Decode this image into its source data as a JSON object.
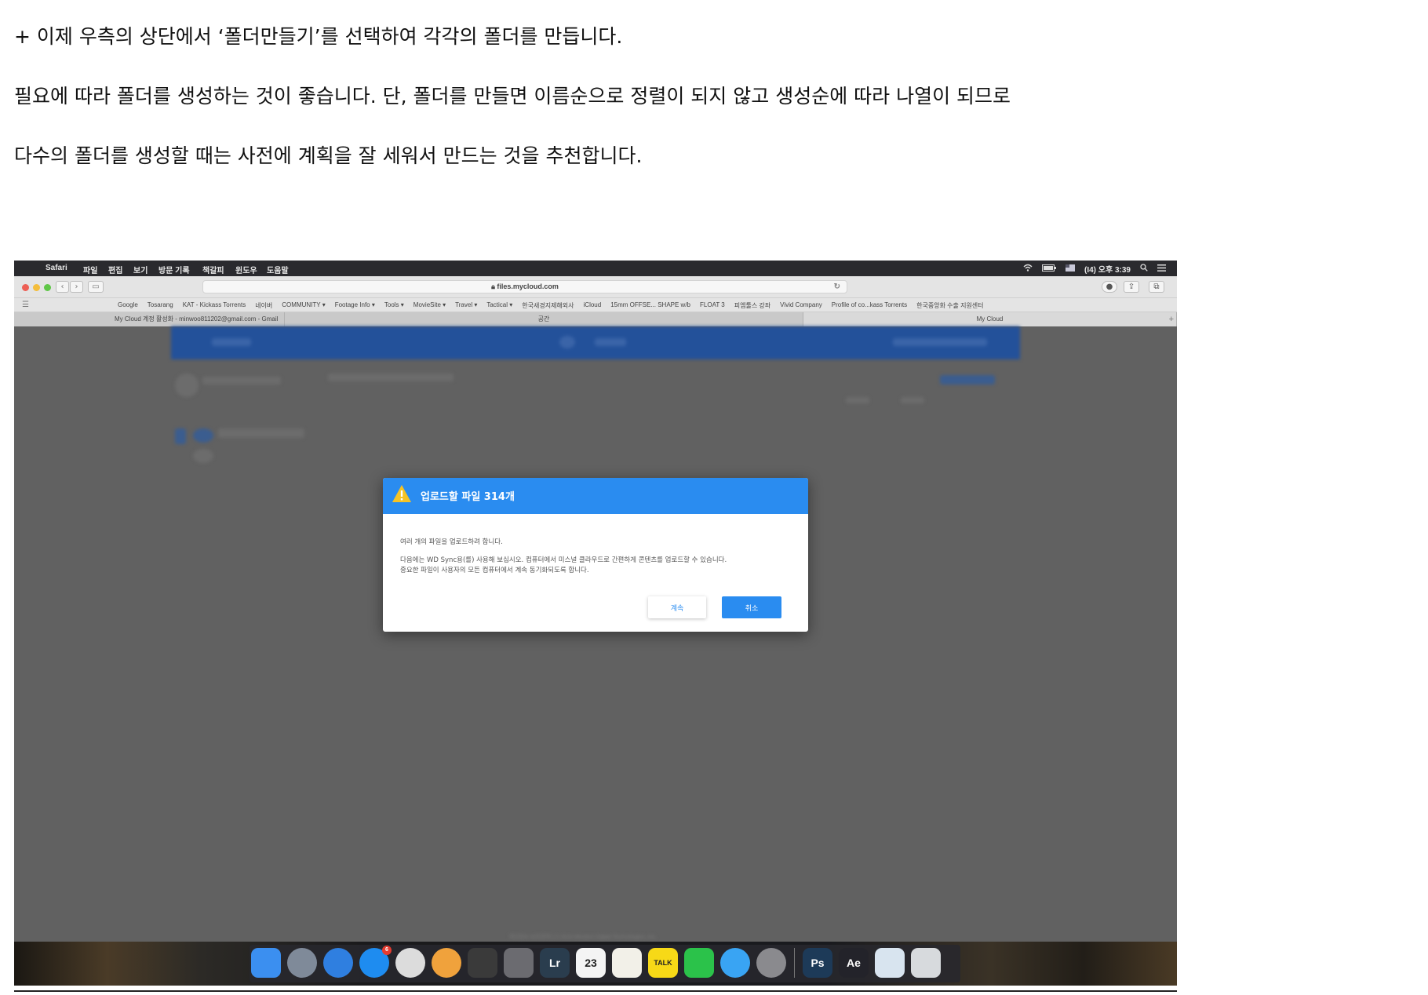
{
  "article": {
    "line1": "+ 이제 우측의 상단에서 ‘폴더만들기’를 선택하여 각각의 폴더를 만듭니다.",
    "line2": "필요에 따라 폴더를 생성하는 것이 좋습니다. 단, 폴더를 만들면 이름순으로 정렬이 되지 않고 생성순에 따라 나열이 되므로",
    "line3": "다수의 폴더를 생성할 때는 사전에 계획을 잘 세워서 만드는 것을 추천합니다."
  },
  "menubar": {
    "app": "Safari",
    "items": [
      "파일",
      "편집",
      "보기",
      "방문 기록",
      "책갈피",
      "윈도우",
      "도움말"
    ],
    "clock": "(I4) 오후 3:39"
  },
  "toolbar": {
    "url": "files.mycloud.com"
  },
  "bookmarks": [
    "Google",
    "Tosarang",
    "KAT - Kickass Torrents",
    "네이버",
    "COMMUNITY ▾",
    "Footage Info ▾",
    "Tools ▾",
    "MovieSite ▾",
    "Travel ▾",
    "Tactical ▾",
    "한국새경지제해외사",
    "iCloud",
    "15mm OFFSE... SHAPE w/b",
    "FLOAT 3",
    "피엠툴스 강좌",
    "Vivid Company",
    "Profile of co...kass Torrents",
    "한국중앙화 수출 지원센터"
  ],
  "tabs": [
    {
      "label": "My Cloud 계정 활성화 - minwoo811202@gmail.com - Gmail",
      "active": false
    },
    {
      "label": "공간",
      "active": false
    },
    {
      "label": "My Cloud",
      "active": true
    }
  ],
  "dialog": {
    "title": "업로드할 파일 314개",
    "body1": "여러 개의 파일을 업로드하려 합니다.",
    "body2": "다음에는 WD Sync용(를) 사용해 보십시오. 컴퓨터에서 미스널 클라우드로 간편하게 콘텐츠를 업로드할 수 있습니다.",
    "body3": "중요한 파일이 사용자의 모든 컴퓨터에서 계속 동기화되도록 합니다.",
    "continue_label": "계속",
    "cancel_label": "취소"
  },
  "footer_note": "개인정보 보호정책 | © 2016 Western Digital Technologies, Inc.",
  "dock": [
    {
      "name": "finder-icon",
      "label": "",
      "color": "#3b8ff0"
    },
    {
      "name": "launchpad-icon",
      "label": "",
      "color": "#7f8a99"
    },
    {
      "name": "safari-icon",
      "label": "",
      "color": "#2f7fe0"
    },
    {
      "name": "app-store-icon",
      "label": "",
      "color": "#1e8cf0",
      "badge": "6"
    },
    {
      "name": "chrome-icon",
      "label": "",
      "color": "#dcdcdc"
    },
    {
      "name": "photos-icon",
      "label": "",
      "color": "#f0a23c"
    },
    {
      "name": "final-cut-icon",
      "label": "",
      "color": "#3a3a3a"
    },
    {
      "name": "motion-icon",
      "label": "",
      "color": "#6b6b70"
    },
    {
      "name": "lightroom-icon",
      "label": "Lr",
      "color": "#2a3d4e"
    },
    {
      "name": "calendar-icon",
      "label": "23",
      "color": "#f4f4f4"
    },
    {
      "name": "notes-icon",
      "label": "",
      "color": "#f2f0e8"
    },
    {
      "name": "kakaotalk-icon",
      "label": "TALK",
      "color": "#f7d917"
    },
    {
      "name": "line-icon",
      "label": "",
      "color": "#2bc24a"
    },
    {
      "name": "messages-icon",
      "label": "",
      "color": "#39a4f3"
    },
    {
      "name": "system-preferences-icon",
      "label": "",
      "color": "#8a8a8e"
    },
    {
      "name": "photoshop-icon",
      "label": "Ps",
      "color": "#1d3a58"
    },
    {
      "name": "media-encoder-icon",
      "label": "Ae",
      "color": "#23232a"
    },
    {
      "name": "preview-icon",
      "label": "",
      "color": "#d8e4ef"
    },
    {
      "name": "trash-icon",
      "label": "",
      "color": "#d7dadd"
    }
  ]
}
